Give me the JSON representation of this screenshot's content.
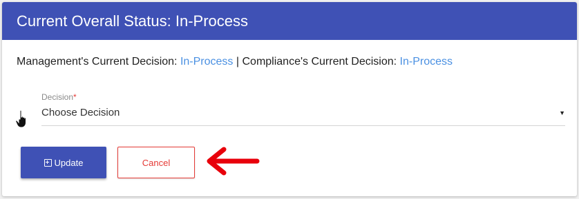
{
  "header": {
    "title": "Current Overall Status: In-Process"
  },
  "decisions": {
    "management_label": "Management's Current Decision:",
    "management_value": "In-Process",
    "separator": "|",
    "compliance_label": "Compliance's Current Decision:",
    "compliance_value": "In-Process"
  },
  "decision_select": {
    "label": "Decision",
    "required_marker": "*",
    "value": "Choose Decision",
    "arrow_icon": "caret-down-icon"
  },
  "buttons": {
    "update_label": "Update",
    "update_icon": "plus-square-icon",
    "cancel_label": "Cancel"
  },
  "annotations": {
    "cursor_icon": "hand-pointer-icon",
    "arrow_icon": "red-arrow-left-icon"
  },
  "colors": {
    "primary": "#3f51b5",
    "status_link": "#4a90e2",
    "danger": "#e53935",
    "annotation_arrow": "#e8000b"
  }
}
